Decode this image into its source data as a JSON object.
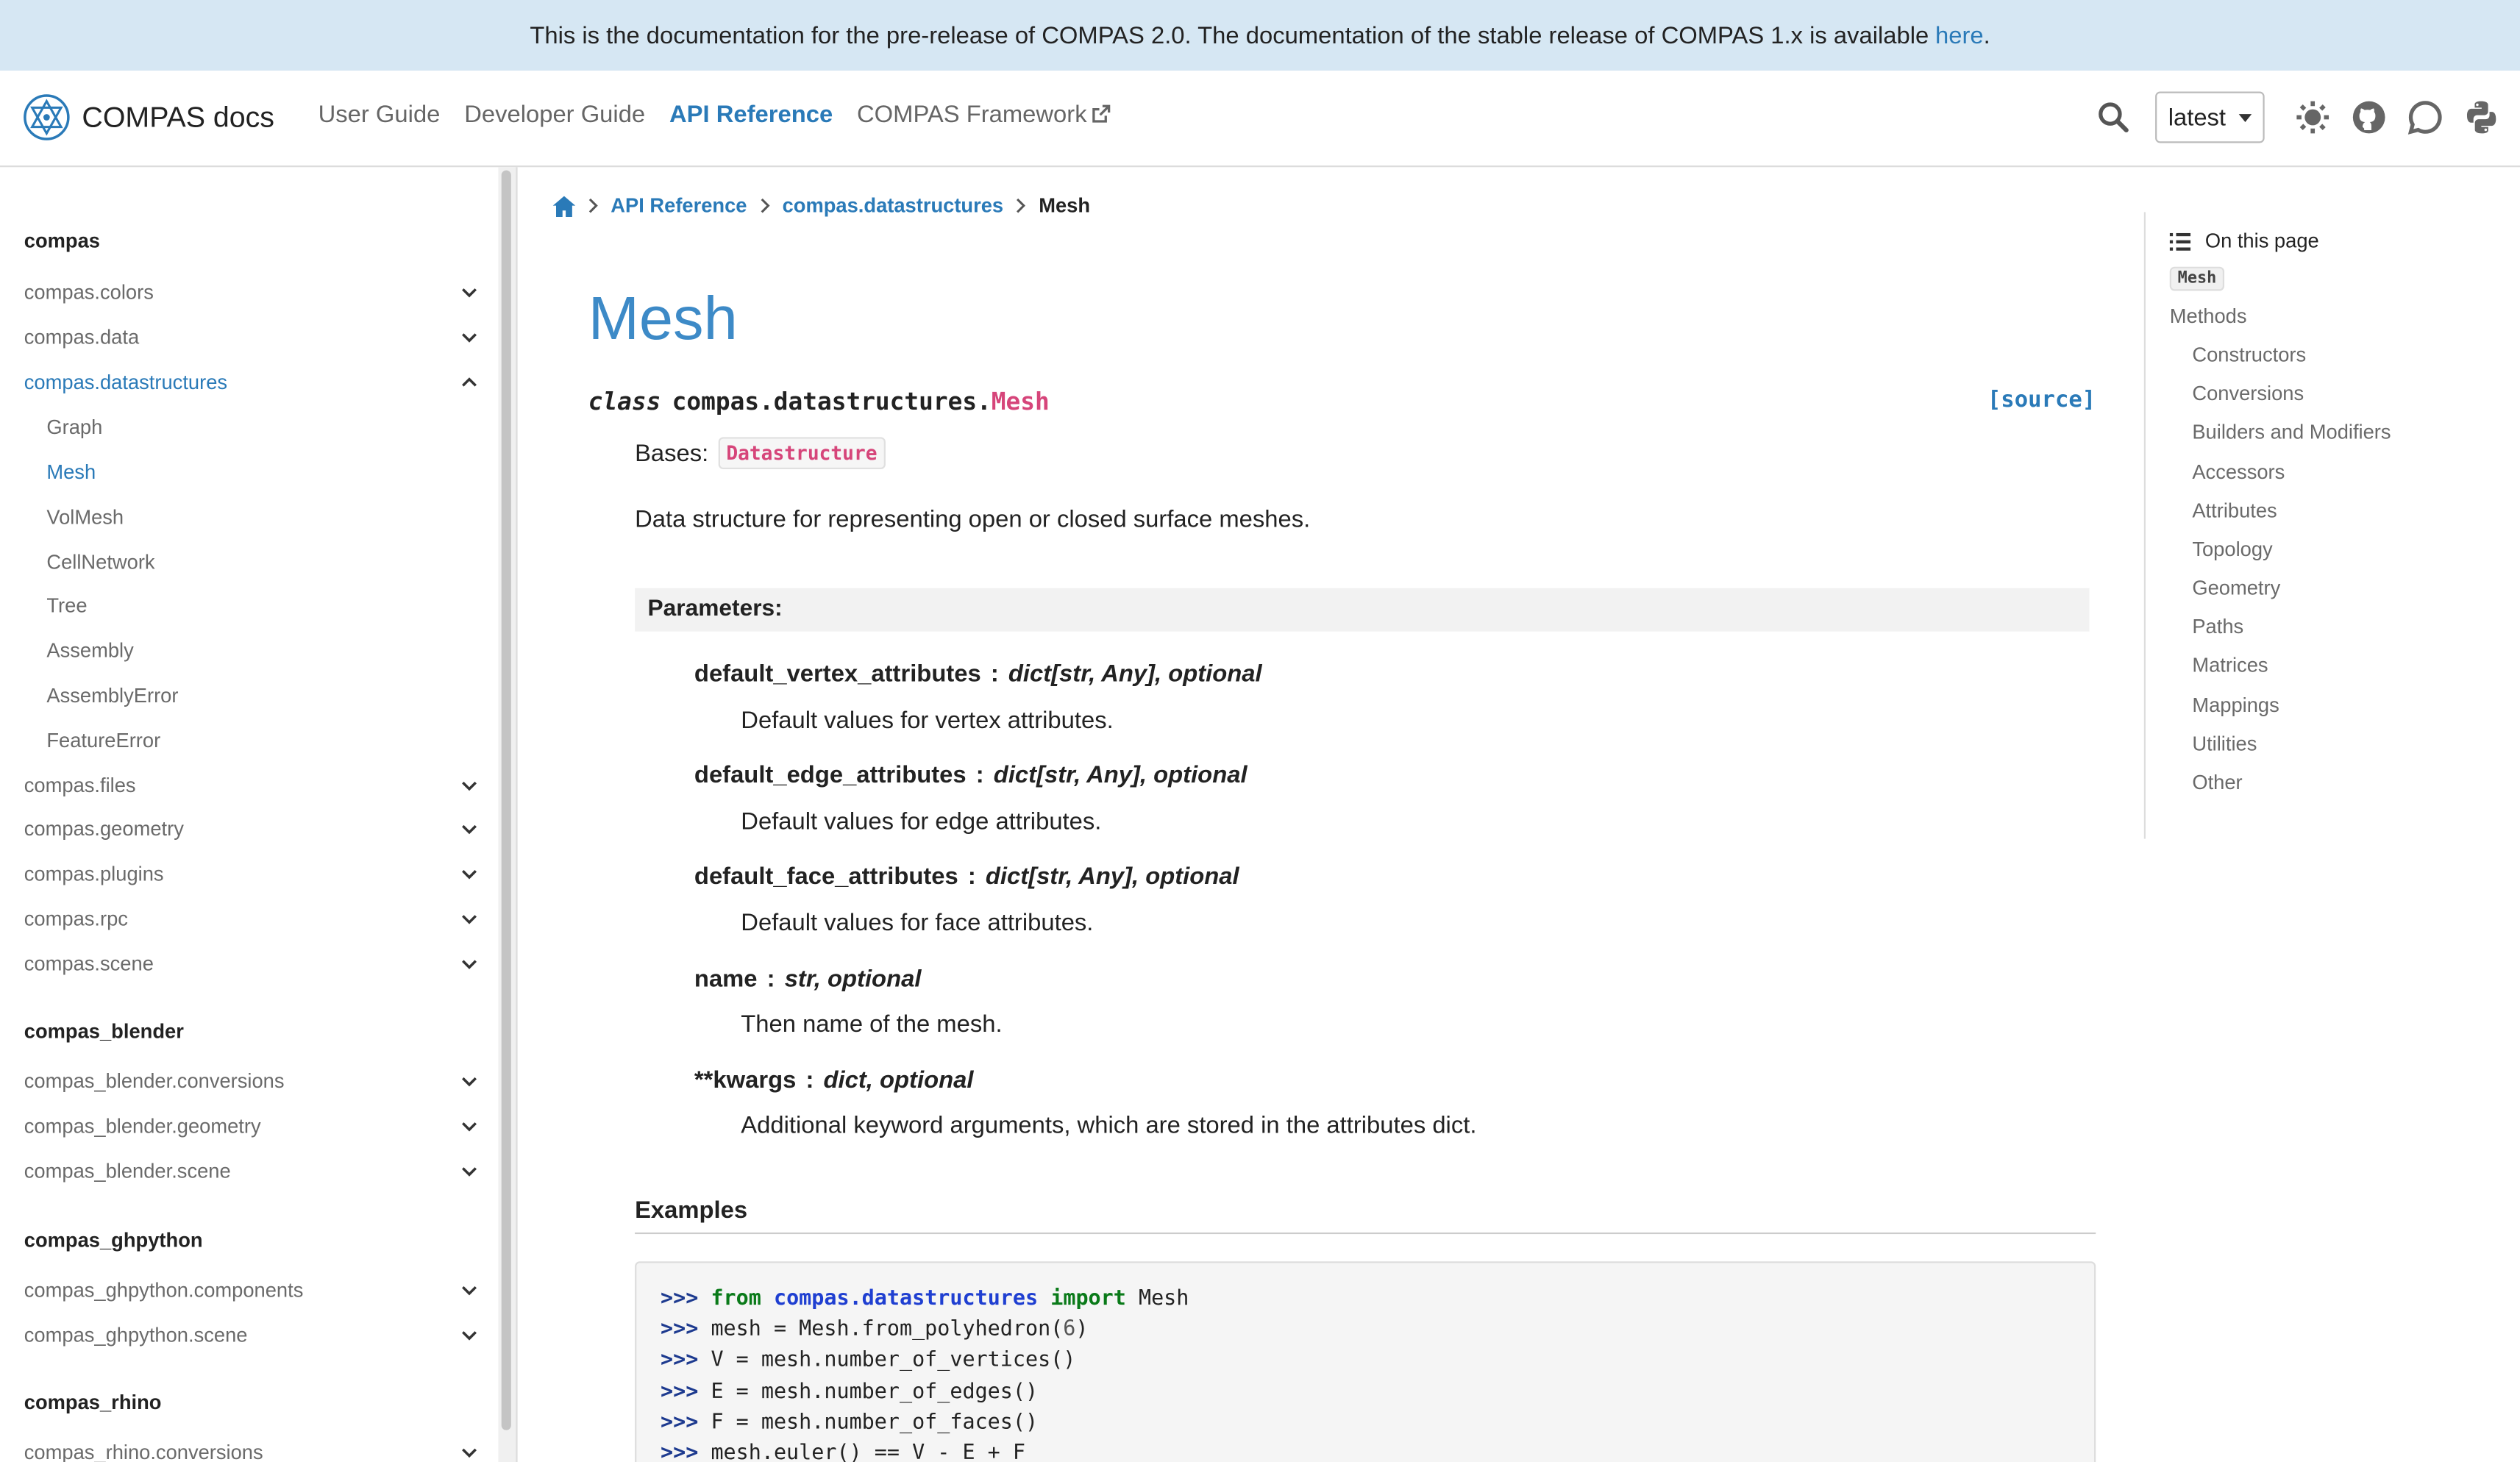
{
  "banner": {
    "text": "This is the documentation for the pre-release of COMPAS 2.0. The documentation of the stable release of COMPAS 1.x is available",
    "link": "here",
    "period": "."
  },
  "navbar": {
    "brand": "COMPAS docs",
    "links": [
      "User Guide",
      "Developer Guide",
      "API Reference",
      "COMPAS Framework"
    ],
    "active": "API Reference",
    "version": "latest",
    "icons": [
      "search-icon",
      "theme-toggle-icon",
      "github-icon",
      "chat-icon",
      "python-icon"
    ]
  },
  "sidebar": {
    "sections": [
      {
        "title": "compas",
        "items": [
          {
            "label": "compas.colors"
          },
          {
            "label": "compas.data"
          },
          {
            "label": "compas.datastructures",
            "expanded": true,
            "children": [
              "Graph",
              "Mesh",
              "VolMesh",
              "CellNetwork",
              "Tree",
              "Assembly",
              "AssemblyError",
              "FeatureError"
            ]
          },
          {
            "label": "compas.files"
          },
          {
            "label": "compas.geometry"
          },
          {
            "label": "compas.plugins"
          },
          {
            "label": "compas.rpc"
          },
          {
            "label": "compas.scene"
          }
        ]
      },
      {
        "title": "compas_blender",
        "items": [
          {
            "label": "compas_blender.conversions"
          },
          {
            "label": "compas_blender.geometry"
          },
          {
            "label": "compas_blender.scene"
          }
        ]
      },
      {
        "title": "compas_ghpython",
        "items": [
          {
            "label": "compas_ghpython.components"
          },
          {
            "label": "compas_ghpython.scene"
          }
        ]
      },
      {
        "title": "compas_rhino",
        "items": [
          {
            "label": "compas_rhino.conversions"
          }
        ]
      }
    ],
    "active": "Mesh"
  },
  "breadcrumb": [
    "API Reference",
    "compas.datastructures",
    "Mesh"
  ],
  "page": {
    "title": "Mesh",
    "signature": {
      "keyword": "class",
      "module": "compas.datastructures.",
      "name": "Mesh"
    },
    "source": "[source]",
    "bases_label": "Bases:",
    "base": "Datastructure",
    "description": "Data structure for representing open or closed surface meshes.",
    "parameters_label": "Parameters:",
    "parameters": [
      {
        "name": "default_vertex_attributes",
        "type": "dict[str, Any], optional",
        "desc": "Default values for vertex attributes."
      },
      {
        "name": "default_edge_attributes",
        "type": "dict[str, Any], optional",
        "desc": "Default values for edge attributes."
      },
      {
        "name": "default_face_attributes",
        "type": "dict[str, Any], optional",
        "desc": "Default values for face attributes."
      },
      {
        "name": "name",
        "type": "str, optional",
        "desc": "Then name of the mesh."
      },
      {
        "name": "**kwargs",
        "type": "dict, optional",
        "desc": "Additional keyword arguments, which are stored in the attributes dict."
      }
    ],
    "examples_label": "Examples",
    "code": [
      {
        "prompt": ">>>",
        "kw": "from",
        "mod": "compas.datastructures",
        "kw2": "import",
        "rest": "Mesh"
      },
      {
        "prompt": ">>>",
        "text": "mesh = Mesh.from_polyhedron(",
        "num": "6",
        "end": ")"
      },
      {
        "prompt": ">>>",
        "text": "V = mesh.number_of_vertices()"
      },
      {
        "prompt": ">>>",
        "text": "E = mesh.number_of_edges()"
      },
      {
        "prompt": ">>>",
        "text": "F = mesh.number_of_faces()"
      },
      {
        "prompt": ">>>",
        "text": "mesh.euler() == V - E + F"
      }
    ]
  },
  "toc": {
    "heading": "On this page",
    "pill": "Mesh",
    "methods": "Methods",
    "items": [
      "Constructors",
      "Conversions",
      "Builders and Modifiers",
      "Accessors",
      "Attributes",
      "Topology",
      "Geometry",
      "Paths",
      "Matrices",
      "Mappings",
      "Utilities",
      "Other"
    ]
  }
}
